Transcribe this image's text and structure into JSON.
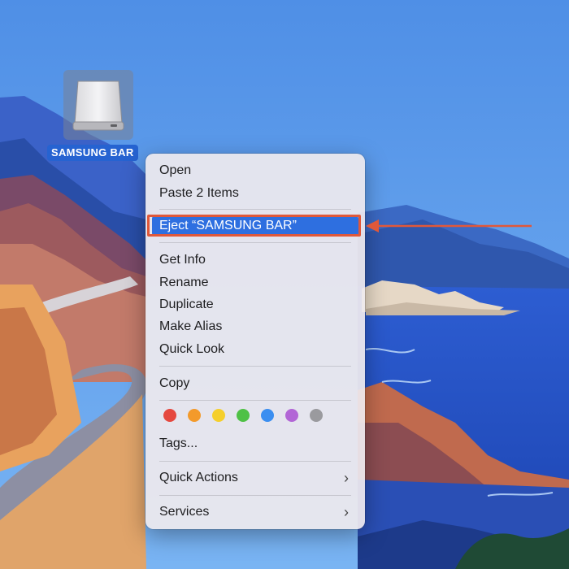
{
  "desktop": {
    "drive_label": "SAMSUNG BAR"
  },
  "context_menu": {
    "items": {
      "open": "Open",
      "paste": "Paste 2 Items",
      "eject": "Eject “SAMSUNG BAR”",
      "get_info": "Get Info",
      "rename": "Rename",
      "duplicate": "Duplicate",
      "make_alias": "Make Alias",
      "quick_look": "Quick Look",
      "copy": "Copy",
      "tags": "Tags...",
      "quick_actions": "Quick Actions",
      "services": "Services"
    },
    "submenu_chevron": "›",
    "tag_colors": [
      {
        "name": "red",
        "hex": "#e5483f"
      },
      {
        "name": "orange",
        "hex": "#f39a2b"
      },
      {
        "name": "yellow",
        "hex": "#f5cf2c"
      },
      {
        "name": "green",
        "hex": "#4fc146"
      },
      {
        "name": "blue",
        "hex": "#3b8ef0"
      },
      {
        "name": "purple",
        "hex": "#b266d6"
      },
      {
        "name": "gray",
        "hex": "#9a9a9e"
      }
    ],
    "selection_color": "#2e6fe0"
  },
  "annotation": {
    "color": "#e0583a",
    "arrow_icon": "arrow-left-icon"
  }
}
